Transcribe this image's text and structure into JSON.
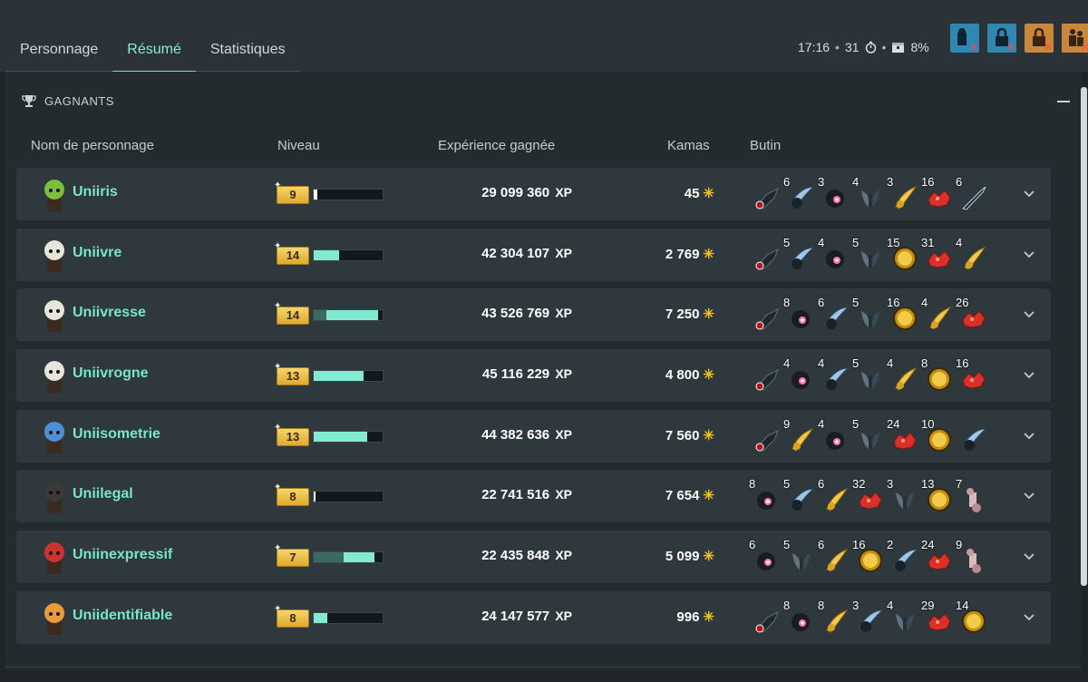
{
  "tabs": [
    {
      "label": "Personnage",
      "active": false
    },
    {
      "label": "Résumé",
      "active": true
    },
    {
      "label": "Statistiques",
      "active": false
    }
  ],
  "status": {
    "time": "17:16",
    "sep": "•",
    "turns": "31",
    "percent": "8%"
  },
  "flags": [
    {
      "icon": "block-spectators-icon",
      "color": "#2f86b0"
    },
    {
      "icon": "lock-combat-icon",
      "color": "#2f86b0"
    },
    {
      "icon": "lock-group-icon",
      "color": "#c8873a"
    },
    {
      "icon": "request-help-icon",
      "color": "#c8873a"
    }
  ],
  "section": {
    "title": "GAGNANTS",
    "icon": "trophy-icon"
  },
  "columns": {
    "name": "Nom de personnage",
    "level": "Niveau",
    "xp": "Expérience gagnée",
    "kamas": "Kamas",
    "loot": "Butin"
  },
  "xp_unit": "XP",
  "colors": {
    "accent": "#79e6c7",
    "kamas": "#f2c21c",
    "row_bg": "#2f383d",
    "badge": "#e8b73a"
  },
  "players": [
    {
      "name": "Uniiris",
      "avatar_color": "#7bbf3a",
      "level": "9",
      "level_progress": 0.05,
      "level_prev": 0.0,
      "xp": "29 099 360",
      "kamas": "45",
      "loot": [
        {
          "count": "",
          "icon": "rune-item-icon"
        },
        {
          "count": "6",
          "icon": "blade-item-icon"
        },
        {
          "count": "3",
          "icon": "orb-item-icon"
        },
        {
          "count": "4",
          "icon": "wing-item-icon"
        },
        {
          "count": "3",
          "icon": "gold-feather-item-icon"
        },
        {
          "count": "16",
          "icon": "red-crystal-item-icon"
        },
        {
          "count": "6",
          "icon": "dark-blade-item-icon"
        }
      ]
    },
    {
      "name": "Uniivre",
      "avatar_color": "#e8e6dc",
      "level": "14",
      "level_progress": 0.37,
      "level_prev": 0.0,
      "xp": "42 304 107",
      "kamas": "2 769",
      "loot": [
        {
          "count": "",
          "icon": "rune-item-icon"
        },
        {
          "count": "5",
          "icon": "blade-item-icon"
        },
        {
          "count": "4",
          "icon": "orb-item-icon"
        },
        {
          "count": "5",
          "icon": "wing-item-icon"
        },
        {
          "count": "15",
          "icon": "gold-coin-item-icon"
        },
        {
          "count": "31",
          "icon": "red-crystal-item-icon"
        },
        {
          "count": "4",
          "icon": "gold-feather-item-icon"
        }
      ]
    },
    {
      "name": "Uniivresse",
      "avatar_color": "#e8e6dc",
      "level": "14",
      "level_progress": 0.93,
      "level_prev": 0.18,
      "xp": "43 526 769",
      "kamas": "7 250",
      "loot": [
        {
          "count": "",
          "icon": "rune-item-icon"
        },
        {
          "count": "8",
          "icon": "orb-item-icon"
        },
        {
          "count": "6",
          "icon": "blade-item-icon"
        },
        {
          "count": "5",
          "icon": "wing-item-icon"
        },
        {
          "count": "16",
          "icon": "gold-coin-item-icon"
        },
        {
          "count": "4",
          "icon": "gold-feather-item-icon"
        },
        {
          "count": "26",
          "icon": "red-crystal-item-icon"
        }
      ]
    },
    {
      "name": "Uniivrogne",
      "avatar_color": "#e8e6dc",
      "level": "13",
      "level_progress": 0.72,
      "level_prev": 0.0,
      "xp": "45 116 229",
      "kamas": "4 800",
      "loot": [
        {
          "count": "",
          "icon": "rune-item-icon"
        },
        {
          "count": "4",
          "icon": "orb-item-icon"
        },
        {
          "count": "4",
          "icon": "blade-item-icon"
        },
        {
          "count": "5",
          "icon": "wing-item-icon"
        },
        {
          "count": "4",
          "icon": "gold-feather-item-icon"
        },
        {
          "count": "8",
          "icon": "gold-coin-item-icon"
        },
        {
          "count": "16",
          "icon": "red-crystal-item-icon"
        }
      ]
    },
    {
      "name": "Uniisometrie",
      "avatar_color": "#4f8fd6",
      "level": "13",
      "level_progress": 0.78,
      "level_prev": 0.0,
      "xp": "44 382 636",
      "kamas": "7 560",
      "loot": [
        {
          "count": "",
          "icon": "rune-item-icon"
        },
        {
          "count": "9",
          "icon": "gold-feather-item-icon"
        },
        {
          "count": "4",
          "icon": "orb-item-icon"
        },
        {
          "count": "5",
          "icon": "wing-item-icon"
        },
        {
          "count": "24",
          "icon": "red-crystal-item-icon"
        },
        {
          "count": "10",
          "icon": "gold-coin-item-icon"
        },
        {
          "count": "",
          "icon": "blade-item-icon"
        }
      ]
    },
    {
      "name": "Uniilegal",
      "avatar_color": "#3a3a3a",
      "level": "8",
      "level_progress": 0.03,
      "level_prev": 0.0,
      "xp": "22 741 516",
      "kamas": "7 654",
      "loot": [
        {
          "count": "8",
          "icon": "orb-item-icon"
        },
        {
          "count": "5",
          "icon": "blade-item-icon"
        },
        {
          "count": "6",
          "icon": "gold-feather-item-icon"
        },
        {
          "count": "32",
          "icon": "red-crystal-item-icon"
        },
        {
          "count": "3",
          "icon": "wing-item-icon"
        },
        {
          "count": "13",
          "icon": "gold-coin-item-icon"
        },
        {
          "count": "7",
          "icon": "bone-item-icon"
        }
      ]
    },
    {
      "name": "Uniinexpressif",
      "avatar_color": "#c9342f",
      "level": "7",
      "level_progress": 0.88,
      "level_prev": 0.43,
      "xp": "22 435 848",
      "kamas": "5 099",
      "loot": [
        {
          "count": "6",
          "icon": "orb-item-icon"
        },
        {
          "count": "5",
          "icon": "wing-item-icon"
        },
        {
          "count": "6",
          "icon": "gold-feather-item-icon"
        },
        {
          "count": "16",
          "icon": "gold-coin-item-icon"
        },
        {
          "count": "2",
          "icon": "blade-item-icon"
        },
        {
          "count": "24",
          "icon": "red-crystal-item-icon"
        },
        {
          "count": "9",
          "icon": "bone-item-icon"
        }
      ]
    },
    {
      "name": "Uniidentifiable",
      "avatar_color": "#e89a3c",
      "level": "8",
      "level_progress": 0.2,
      "level_prev": 0.0,
      "xp": "24 147 577",
      "kamas": "996",
      "loot": [
        {
          "count": "",
          "icon": "rune-item-icon"
        },
        {
          "count": "8",
          "icon": "orb-item-icon"
        },
        {
          "count": "8",
          "icon": "gold-feather-item-icon"
        },
        {
          "count": "3",
          "icon": "blade-item-icon"
        },
        {
          "count": "4",
          "icon": "wing-item-icon"
        },
        {
          "count": "29",
          "icon": "red-crystal-item-icon"
        },
        {
          "count": "14",
          "icon": "gold-coin-item-icon"
        }
      ]
    }
  ]
}
